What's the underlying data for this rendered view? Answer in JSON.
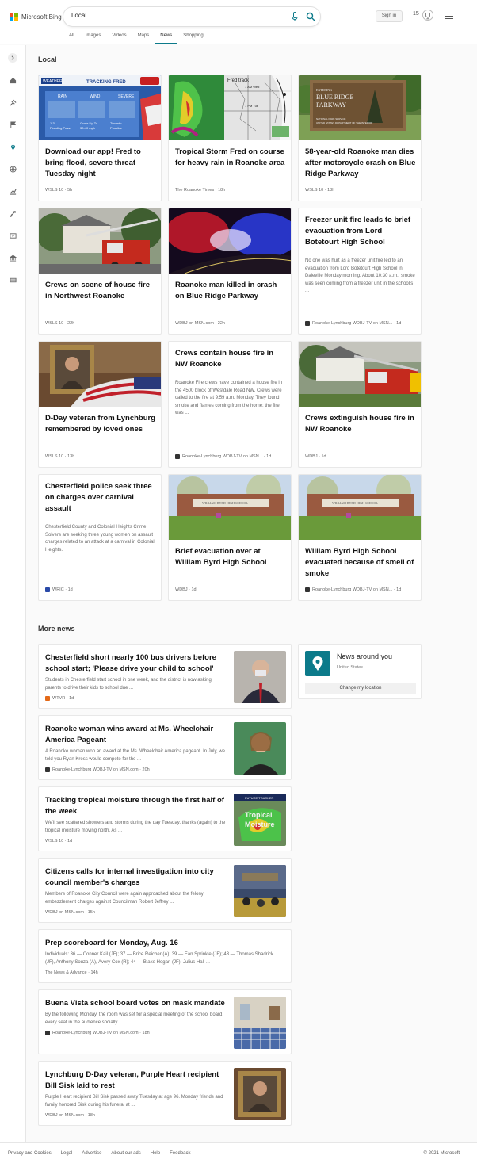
{
  "header": {
    "brand": "Microsoft Bing",
    "query": "Local",
    "sign_in": "Sign in",
    "rewards_count": "15",
    "tabs": [
      "All",
      "Images",
      "Videos",
      "Maps",
      "News",
      "Shopping"
    ],
    "active_tab": "News"
  },
  "sidebar": {
    "icons": [
      "expand-icon",
      "home-icon",
      "headlines-icon",
      "flag-icon",
      "location-icon",
      "world-icon",
      "business-icon",
      "science-icon",
      "entertainment-icon",
      "politics-icon",
      "money-icon"
    ],
    "active": "location-icon",
    "accent": "#0c7a8a"
  },
  "local": {
    "heading": "Local",
    "cards": [
      {
        "title": "Download our app! Fred to bring flood, severe threat Tuesday night",
        "source": "WSLS 10",
        "time": "5h",
        "image": "weather-map"
      },
      {
        "title": "Tropical Storm Fred on course for heavy rain in Roanoke area",
        "source": "The Roanoke Times",
        "time": "18h",
        "image": "storm-track"
      },
      {
        "title": "58-year-old Roanoke man dies after motorcycle crash on Blue Ridge Parkway",
        "source": "WSLS 10",
        "time": "18h",
        "image": "parkway-sign"
      },
      {
        "title": "Crews on scene of house fire in Northwest Roanoke",
        "source": "WSLS 10",
        "time": "22h",
        "image": "fire-truck"
      },
      {
        "title": "Roanoke man killed in crash on Blue Ridge Parkway",
        "source": "WDBJ on MSN.com",
        "time": "22h",
        "image": "police-lights"
      },
      {
        "title": "Freezer unit fire leads to brief evacuation from Lord Botetourt High School",
        "snippet": "No one was hurt as a freezer unit fire led to an evacuation from Lord Botetourt High School in Daleville Monday morning. About 10:30 a.m., smoke was seen coming from a freezer unit in the school's ...",
        "source": "Roanoke-Lynchburg WDBJ-TV on MSN...",
        "time": "1d"
      },
      {
        "title": "D-Day veteran from Lynchburg remembered by loved ones",
        "source": "WSLS 10",
        "time": "13h",
        "image": "portrait-flag"
      },
      {
        "title": "Crews contain house fire in NW Roanoke",
        "snippet": "Roanoke Fire crews have contained a house fire in the 4500 block of Westdale Road NW. Crews were called to the fire at 9:59 a.m. Monday. They found smoke and flames coming from the home; the fire was ...",
        "source": "Roanoke-Lynchburg WDBJ-TV on MSN...",
        "time": "1d"
      },
      {
        "title": "Crews extinguish house fire in NW Roanoke",
        "source": "WDBJ",
        "time": "1d",
        "image": "fire-truck"
      },
      {
        "title": "Chesterfield police seek three on charges over carnival assault",
        "snippet": "Chesterfield County and Colonial Heights Crime Solvers are seeking three young women on assault charges related to an attack at a carnival in Colonial Heights.",
        "source": "WRIC",
        "time": "1d"
      },
      {
        "title": "Brief evacuation over at William Byrd High School",
        "source": "WDBJ",
        "time": "1d",
        "image": "school"
      },
      {
        "title": "William Byrd High School evacuated because of smell of smoke",
        "source": "Roanoke-Lynchburg WDBJ-TV on MSN...",
        "time": "1d",
        "image": "school"
      }
    ]
  },
  "more_news": {
    "heading": "More news",
    "items": [
      {
        "title": "Chesterfield short nearly 100 bus drivers before school start; 'Please drive your child to school'",
        "snippet": "Students in Chesterfield start school in one week, and the district is now asking parents to drive their kids to school due ...",
        "source": "WTVR",
        "time": "1d",
        "image": "man-mask"
      },
      {
        "title": "Roanoke woman wins award at Ms. Wheelchair America Pageant",
        "snippet": "A Roanoke woman won an award at the Ms. Wheelchair America pageant. In July, we told you Ryan Kress would compete for the ...",
        "source": "Roanoke-Lynchburg WDBJ-TV on MSN.com",
        "time": "20h",
        "image": "woman"
      },
      {
        "title": "Tracking tropical moisture through the first half of the week",
        "snippet": "We'll see scattered showers and storms during the day Tuesday, thanks (again) to the tropical moisture moving north. As ...",
        "source": "WSLS 10",
        "time": "1d",
        "image": "radar",
        "image_text": [
          "FUTURE TRACKER",
          "Tropical",
          "Moisture"
        ]
      },
      {
        "title": "Citizens calls for internal investigation into city council member's charges",
        "snippet": "Members of Roanoke City Council were again approached about the felony embezzlement charges against Councilman Robert Jeffrey ...",
        "source": "WDBJ on MSN.com",
        "time": "15h",
        "image": "council"
      },
      {
        "title": "Prep scoreboard for Monday, Aug. 16",
        "snippet": "Individuals: 36 — Conner Kail (JF); 37 — Brice Reicher (A); 39 — Ean Sprinkle (JF); 43 — Thomas Shadrick (JF), Anthony Souza (A), Avery Cox (R); 44 — Blake Hogan (JF), Julius Hall ...",
        "source": "The News & Advance",
        "time": "14h"
      },
      {
        "title": "Buena Vista school board votes on mask mandate",
        "snippet": "By the following Monday, the room was set for a special meeting of the school board, every seat in the audience socially ...",
        "source": "Roanoke-Lynchburg WDBJ-TV on MSN.com",
        "time": "18h",
        "image": "room"
      },
      {
        "title": "Lynchburg D-Day veteran, Purple Heart recipient Bill Sisk laid to rest",
        "snippet": "Purple Heart recipient Bill Sisk passed away Tuesday at age 96. Monday friends and family honored Sisk during his funeral at ...",
        "source": "WDBJ on MSN.com",
        "time": "18h",
        "image": "portrait"
      }
    ]
  },
  "news_around": {
    "title": "News around you",
    "location": "United States",
    "button": "Change my location"
  },
  "image_text": {
    "weather_title": "TRACKING FRED",
    "weather_logo": "WEATHER",
    "weather_cols": [
      "RAIN",
      "WIND",
      "SEVERE"
    ],
    "weather_vals": [
      "1-3\"",
      "Gusts Up To",
      "Tornado"
    ],
    "weather_vals2": [
      "Flooding Poss.",
      "30-40 mph",
      "Possible"
    ],
    "storm_title": "Fred track",
    "storm_t1": "1 AM Wed",
    "storm_t2": "1 PM Tue",
    "parkway_top": "ENTERING",
    "parkway_name1": "BLUE RIDGE",
    "parkway_name2": "PARKWAY",
    "parkway_sub1": "NATIONAL PARK SERVICE",
    "parkway_sub2": "UNITED STATES DEPARTMENT OF THE INTERIOR",
    "school_sign": "WILLIAM BYRD HIGH SCHOOL"
  },
  "footer": {
    "links": [
      "Privacy and Cookies",
      "Legal",
      "Advertise",
      "About our ads",
      "Help",
      "Feedback"
    ],
    "copyright": "© 2021 Microsoft"
  }
}
